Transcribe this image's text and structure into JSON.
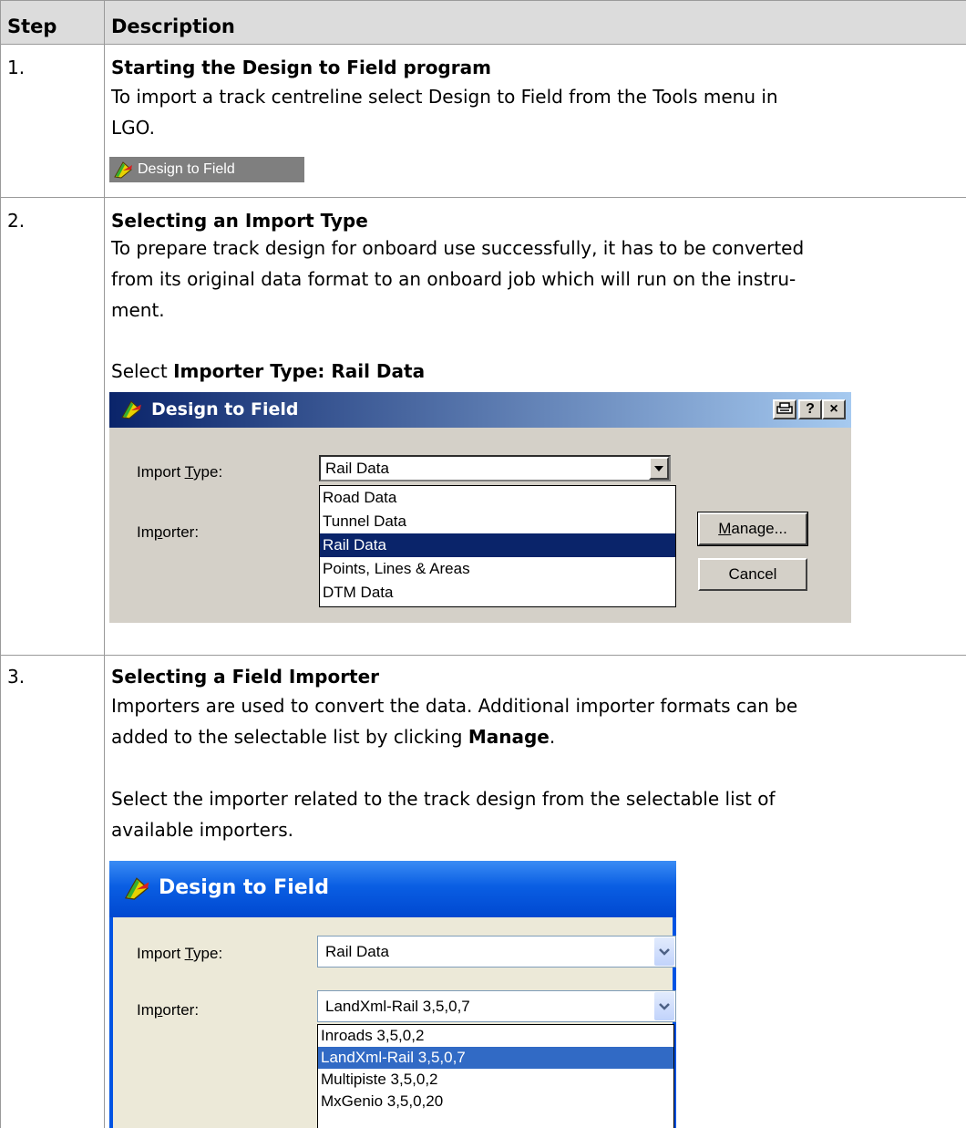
{
  "table": {
    "headers": [
      "Step",
      "Description"
    ]
  },
  "steps": [
    {
      "number": "1.",
      "title": "Starting the Design to Field program",
      "lines": [
        "To import a track centreline select Design to Field from the Tools menu in",
        "LGO."
      ],
      "tool_button_label": "Design to Field"
    },
    {
      "number": "2.",
      "title": "Selecting an Import Type",
      "lines": [
        "To prepare track design for onboard use successfully, it has to be converted",
        "from its original data format to an onboard job which will run on the instru-",
        "ment."
      ],
      "select_prefix": "Select ",
      "select_bold": "Importer Type: Rail Data"
    },
    {
      "number": "3.",
      "title": "Selecting a Field Importer",
      "lines": [
        "Importers are used to convert the data. Additional importer formats can be"
      ],
      "line2_prefix": "added to the selectable list by clicking ",
      "line2_bold": "Manage",
      "line2_suffix": ".",
      "lines_after": [
        "Select the importer related to the track design from the selectable list of",
        "available importers."
      ]
    }
  ],
  "dialog1": {
    "title": "Design to Field",
    "import_type_pre": "Import ",
    "import_type_u": "T",
    "import_type_post": "ype:",
    "importer_pre": "Im",
    "importer_u": "p",
    "importer_post": "orter:",
    "import_type_value": "Rail Data",
    "import_type_options": [
      "Road Data",
      "Tunnel Data",
      "Rail Data",
      "Points, Lines & Areas",
      "DTM Data"
    ],
    "selected_option": "Rail Data",
    "manage_u": "M",
    "manage_rest": "anage...",
    "cancel_label": "Cancel",
    "help_glyph": "?",
    "close_glyph": "×"
  },
  "dialog2": {
    "title": "Design to Field",
    "import_type_pre": "Import ",
    "import_type_u": "T",
    "import_type_post": "ype:",
    "importer_pre": "Im",
    "importer_u": "p",
    "importer_post": "orter:",
    "import_type_value": "Rail Data",
    "importer_value": "LandXml-Rail 3,5,0,7",
    "importer_options": [
      "Inroads 3,5,0,2",
      "LandXml-Rail 3,5,0,7",
      "Multipiste 3,5,0,2",
      "MxGenio 3,5,0,20"
    ],
    "selected_option": "LandXml-Rail 3,5,0,7"
  },
  "colors": {
    "header_bg": "#dcdcdc",
    "dialog_classic_bg": "#d4d0c8",
    "dialog_xp_bg": "#ece9d8",
    "selection_classic": "#0a246a",
    "selection_xp": "#316ac5"
  }
}
